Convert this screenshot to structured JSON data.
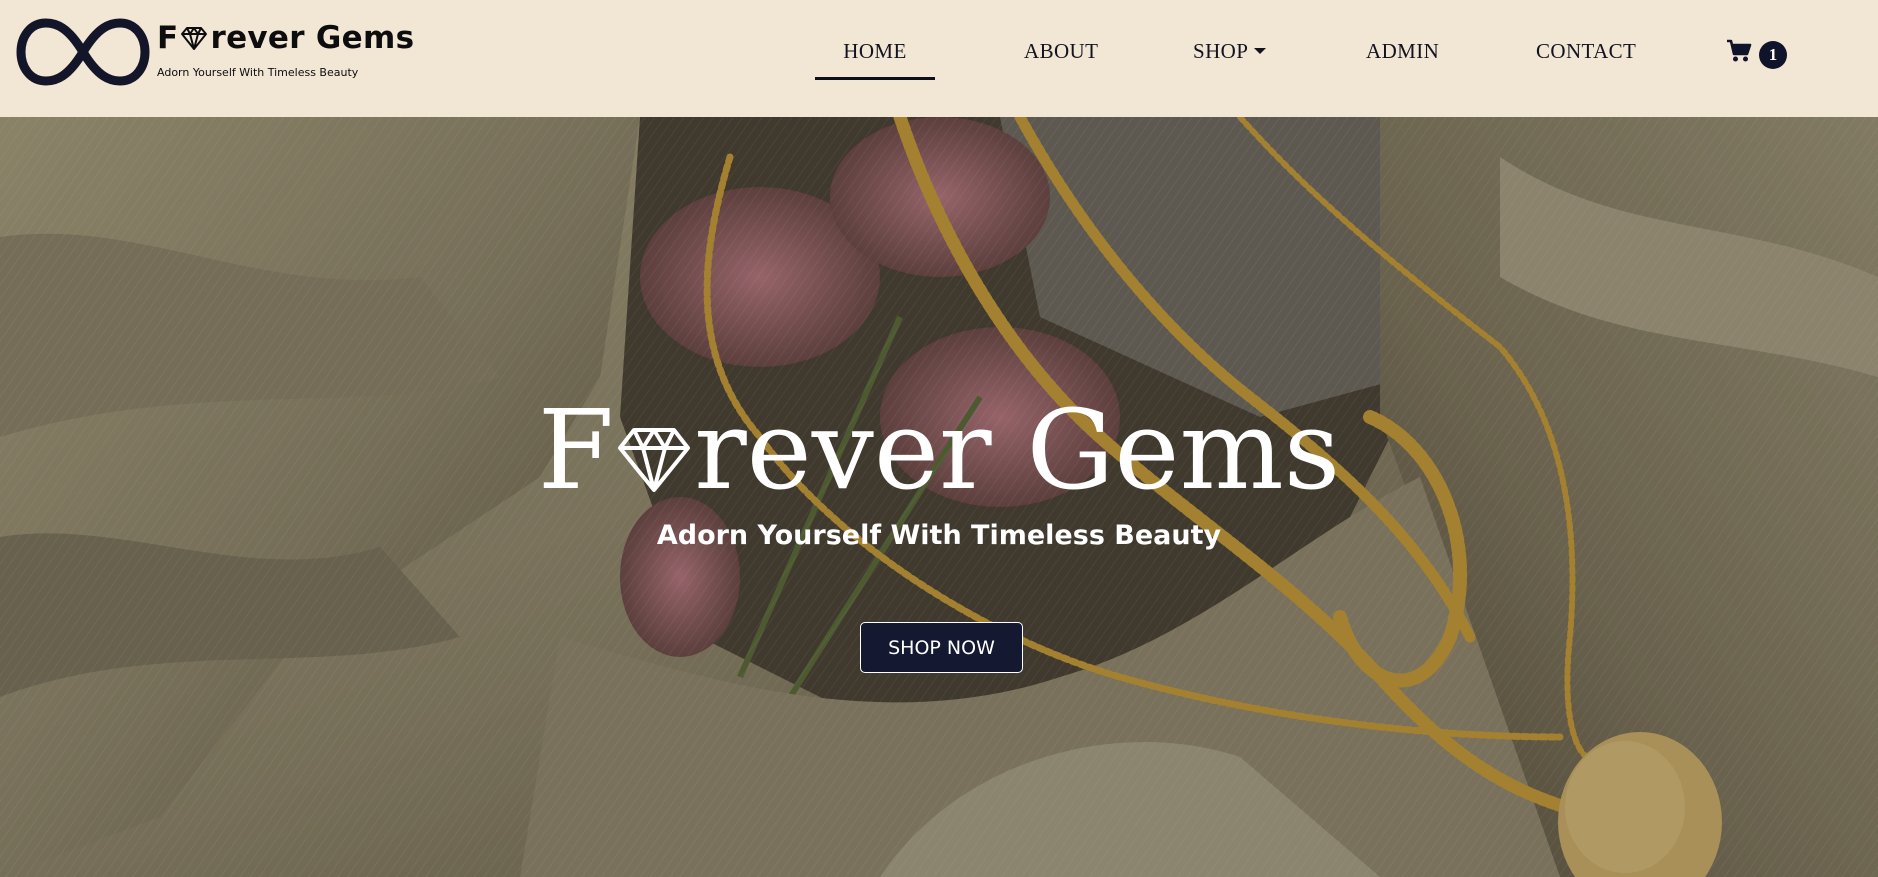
{
  "brand": {
    "name_prefix": "F",
    "name_suffix": "rever Gems",
    "tagline": "Adorn Yourself  With Timeless Beauty",
    "logo_icon": "infinity-icon",
    "gem_icon": "diamond-icon"
  },
  "nav": {
    "items": [
      {
        "label": "HOME",
        "active": true
      },
      {
        "label": "ABOUT"
      },
      {
        "label": "SHOP",
        "dropdown": true
      },
      {
        "label": "ADMIN"
      },
      {
        "label": "CONTACT"
      }
    ],
    "cart": {
      "icon": "cart-icon",
      "count": "1"
    }
  },
  "hero": {
    "title_prefix": "F",
    "title_suffix": "rever Gems",
    "subtitle": "Adorn Yourself With Timeless Beauty",
    "cta_label": "SHOP NOW",
    "background": "gold-chain-necklaces-on-cream-fabric-photo"
  },
  "colors": {
    "navbar_bg": "#f2e6d4",
    "text_dark": "#0d0d10",
    "button_bg": "#141830",
    "badge_bg": "#10142a"
  }
}
